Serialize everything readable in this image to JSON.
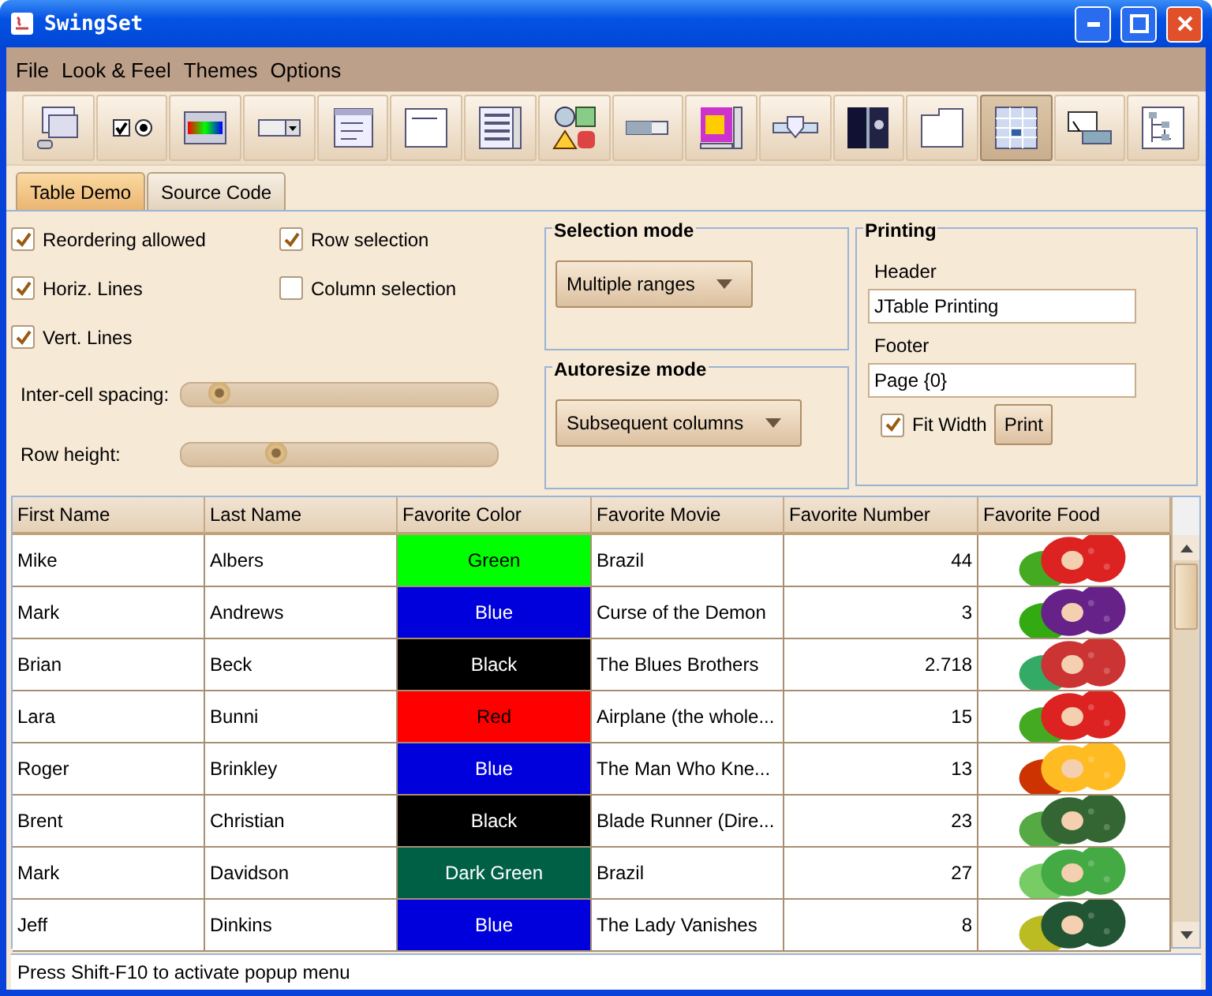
{
  "window": {
    "title": "SwingSet"
  },
  "menu": [
    "File",
    "Look & Feel",
    "Themes",
    "Options"
  ],
  "toolbar": [
    {
      "selected": false
    },
    {
      "selected": false
    },
    {
      "selected": false
    },
    {
      "selected": false
    },
    {
      "selected": false
    },
    {
      "selected": false
    },
    {
      "selected": false
    },
    {
      "selected": false
    },
    {
      "selected": false
    },
    {
      "selected": false
    },
    {
      "selected": false
    },
    {
      "selected": false
    },
    {
      "selected": false
    },
    {
      "selected": true
    },
    {
      "selected": false
    },
    {
      "selected": false
    }
  ],
  "tabs": [
    {
      "label": "Table Demo",
      "selected": true
    },
    {
      "label": "Source Code",
      "selected": false
    }
  ],
  "options": [
    {
      "label": "Reordering allowed",
      "checked": true
    },
    {
      "label": "Row selection",
      "checked": true
    },
    {
      "label": "Horiz. Lines",
      "checked": true
    },
    {
      "label": "Column selection",
      "checked": false
    },
    {
      "label": "Vert. Lines",
      "checked": true
    }
  ],
  "sliders": [
    {
      "label": "Inter-cell spacing:",
      "level": 0.12
    },
    {
      "label": "Row height:",
      "level": 0.3
    }
  ],
  "selection_mode": {
    "title": "Selection mode",
    "value": "Multiple ranges"
  },
  "autoresize_mode": {
    "title": "Autoresize mode",
    "value": "Subsequent columns"
  },
  "printing": {
    "title": "Printing",
    "header_label": "Header",
    "header_value": "JTable Printing",
    "footer_label": "Footer",
    "footer_value": "Page {0}",
    "fit_width": {
      "label": "Fit Width",
      "checked": true
    },
    "print_button": "Print"
  },
  "table": {
    "columns": [
      "First Name",
      "Last Name",
      "Favorite Color",
      "Favorite Movie",
      "Favorite Number",
      "Favorite Food"
    ],
    "rows": [
      {
        "first": "Mike",
        "last": "Albers",
        "color_name": "Green",
        "color": "#00ff00",
        "movie": "Brazil",
        "number": "44"
      },
      {
        "first": "Mark",
        "last": "Andrews",
        "color_name": "Blue",
        "color": "#0000dd",
        "movie": "Curse of the Demon",
        "number": "3"
      },
      {
        "first": "Brian",
        "last": "Beck",
        "color_name": "Black",
        "color": "#000000",
        "movie": "The Blues Brothers",
        "number": "2.718"
      },
      {
        "first": "Lara",
        "last": "Bunni",
        "color_name": "Red",
        "color": "#ff0000",
        "movie": "Airplane (the whole...",
        "number": "15"
      },
      {
        "first": "Roger",
        "last": "Brinkley",
        "color_name": "Blue",
        "color": "#0000dd",
        "movie": "The Man Who Kne...",
        "number": "13"
      },
      {
        "first": "Brent",
        "last": "Christian",
        "color_name": "Black",
        "color": "#000000",
        "movie": "Blade Runner (Dire...",
        "number": "23"
      },
      {
        "first": "Mark",
        "last": "Davidson",
        "color_name": "Dark Green",
        "color": "#006046",
        "movie": "Brazil",
        "number": "27"
      },
      {
        "first": "Jeff",
        "last": "Dinkins",
        "color_name": "Blue",
        "color": "#0000dd",
        "movie": "The Lady Vanishes",
        "number": "8"
      }
    ]
  },
  "status_bar": "Press Shift-F10 to activate popup menu"
}
